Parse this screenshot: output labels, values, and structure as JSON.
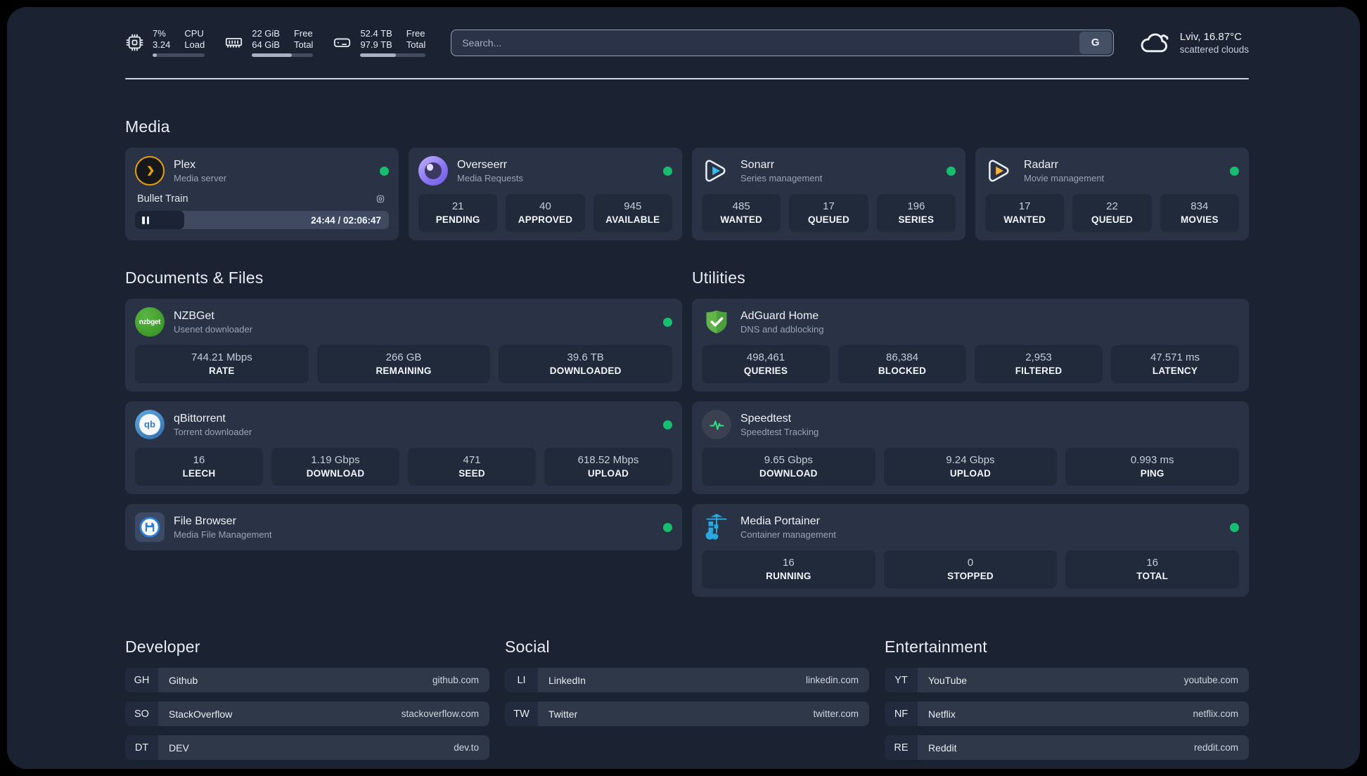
{
  "header": {
    "system_stats": [
      {
        "icon": "cpu",
        "col1": [
          "7%",
          "3.24"
        ],
        "col2": [
          "CPU",
          "Load"
        ],
        "progress_pct": 8
      },
      {
        "icon": "ram",
        "col1": [
          "22 GiB",
          "64 GiB"
        ],
        "col2": [
          "Free",
          "Total"
        ],
        "progress_pct": 65
      },
      {
        "icon": "disk",
        "col1": [
          "52.4 TB",
          "97.9 TB"
        ],
        "col2": [
          "Free",
          "Total"
        ],
        "progress_pct": 55
      }
    ],
    "search": {
      "placeholder": "Search...",
      "button_label": "G"
    },
    "weather": {
      "location": "Lviv, 16.87°C",
      "condition": "scattered clouds"
    }
  },
  "sections": {
    "media": "Media",
    "documents": "Documents & Files",
    "utilities": "Utilities",
    "developer": "Developer",
    "social": "Social",
    "entertainment": "Entertainment"
  },
  "apps": {
    "plex": {
      "name": "Plex",
      "description": "Media server",
      "online": true,
      "player": {
        "title": "Bullet Train",
        "time": "24:44 / 02:06:47",
        "progress_pct": 19.5
      }
    },
    "overseerr": {
      "name": "Overseerr",
      "description": "Media Requests",
      "online": true,
      "stats": [
        {
          "value": "21",
          "label": "PENDING"
        },
        {
          "value": "40",
          "label": "APPROVED"
        },
        {
          "value": "945",
          "label": "AVAILABLE"
        }
      ]
    },
    "sonarr": {
      "name": "Sonarr",
      "description": "Series management",
      "online": true,
      "stats": [
        {
          "value": "485",
          "label": "WANTED"
        },
        {
          "value": "17",
          "label": "QUEUED"
        },
        {
          "value": "196",
          "label": "SERIES"
        }
      ]
    },
    "radarr": {
      "name": "Radarr",
      "description": "Movie management",
      "online": true,
      "stats": [
        {
          "value": "17",
          "label": "WANTED"
        },
        {
          "value": "22",
          "label": "QUEUED"
        },
        {
          "value": "834",
          "label": "MOVIES"
        }
      ]
    },
    "nzbget": {
      "name": "NZBGet",
      "description": "Usenet downloader",
      "online": true,
      "icon_text": "nzbget",
      "stats": [
        {
          "value": "744.21 Mbps",
          "label": "RATE"
        },
        {
          "value": "266 GB",
          "label": "REMAINING"
        },
        {
          "value": "39.6 TB",
          "label": "DOWNLOADED"
        }
      ]
    },
    "qbittorrent": {
      "name": "qBittorrent",
      "description": "Torrent downloader",
      "online": true,
      "icon_text": "qb",
      "stats": [
        {
          "value": "16",
          "label": "LEECH"
        },
        {
          "value": "1.19 Gbps",
          "label": "DOWNLOAD"
        },
        {
          "value": "471",
          "label": "SEED"
        },
        {
          "value": "618.52 Mbps",
          "label": "UPLOAD"
        }
      ]
    },
    "filebrowser": {
      "name": "File Browser",
      "description": "Media File Management",
      "online": true
    },
    "adguard": {
      "name": "AdGuard Home",
      "description": "DNS and adblocking",
      "stats": [
        {
          "value": "498,461",
          "label": "QUERIES"
        },
        {
          "value": "86,384",
          "label": "BLOCKED"
        },
        {
          "value": "2,953",
          "label": "FILTERED"
        },
        {
          "value": "47.571 ms",
          "label": "LATENCY"
        }
      ]
    },
    "speedtest": {
      "name": "Speedtest",
      "description": "Speedtest Tracking",
      "stats": [
        {
          "value": "9.65 Gbps",
          "label": "DOWNLOAD"
        },
        {
          "value": "9.24 Gbps",
          "label": "UPLOAD"
        },
        {
          "value": "0.993 ms",
          "label": "PING"
        }
      ]
    },
    "portainer": {
      "name": "Media Portainer",
      "description": "Container management",
      "online": true,
      "stats": [
        {
          "value": "16",
          "label": "RUNNING"
        },
        {
          "value": "0",
          "label": "STOPPED"
        },
        {
          "value": "16",
          "label": "TOTAL"
        }
      ]
    }
  },
  "bookmarks": {
    "developer": [
      {
        "abbr": "GH",
        "name": "Github",
        "url": "github.com"
      },
      {
        "abbr": "SO",
        "name": "StackOverflow",
        "url": "stackoverflow.com"
      },
      {
        "abbr": "DT",
        "name": "DEV",
        "url": "dev.to"
      }
    ],
    "social": [
      {
        "abbr": "LI",
        "name": "LinkedIn",
        "url": "linkedin.com"
      },
      {
        "abbr": "TW",
        "name": "Twitter",
        "url": "twitter.com"
      }
    ],
    "entertainment": [
      {
        "abbr": "YT",
        "name": "YouTube",
        "url": "youtube.com"
      },
      {
        "abbr": "NF",
        "name": "Netflix",
        "url": "netflix.com"
      },
      {
        "abbr": "RE",
        "name": "Reddit",
        "url": "reddit.com"
      }
    ]
  },
  "colors": {
    "online_green": "#17be70",
    "plex_gold": "#e5a00d",
    "page_bg": "#1b2333",
    "card_bg": "#2a3245"
  }
}
